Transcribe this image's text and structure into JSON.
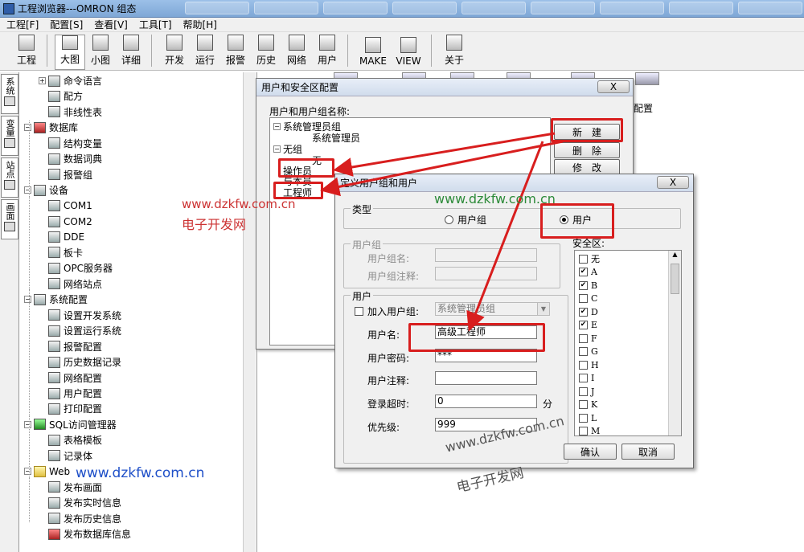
{
  "window": {
    "title": "工程浏览器---OMRON 组态"
  },
  "menu": [
    "工程[F]",
    "配置[S]",
    "查看[V]",
    "工具[T]",
    "帮助[H]"
  ],
  "toolbar": [
    "工程",
    "大图",
    "小图",
    "详细",
    "开发",
    "运行",
    "报警",
    "历史",
    "网络",
    "用户",
    "MAKE",
    "VIEW",
    "关于"
  ],
  "side_tabs": [
    "系统",
    "变量",
    "站点",
    "画面"
  ],
  "tree": [
    {
      "label": "命令语言",
      "level": 1,
      "exp": "+"
    },
    {
      "label": "配方",
      "level": 1
    },
    {
      "label": "非线性表",
      "level": 1
    },
    {
      "label": "数据库",
      "level": 0,
      "exp": "-"
    },
    {
      "label": "结构变量",
      "level": 1
    },
    {
      "label": "数据词典",
      "level": 1
    },
    {
      "label": "报警组",
      "level": 1
    },
    {
      "label": "设备",
      "level": 0,
      "exp": "-"
    },
    {
      "label": "COM1",
      "level": 1
    },
    {
      "label": "COM2",
      "level": 1
    },
    {
      "label": "DDE",
      "level": 1
    },
    {
      "label": "板卡",
      "level": 1
    },
    {
      "label": "OPC服务器",
      "level": 1
    },
    {
      "label": "网络站点",
      "level": 1
    },
    {
      "label": "系统配置",
      "level": 0,
      "exp": "-"
    },
    {
      "label": "设置开发系统",
      "level": 1
    },
    {
      "label": "设置运行系统",
      "level": 1
    },
    {
      "label": "报警配置",
      "level": 1
    },
    {
      "label": "历史数据记录",
      "level": 1
    },
    {
      "label": "网络配置",
      "level": 1
    },
    {
      "label": "用户配置",
      "level": 1
    },
    {
      "label": "打印配置",
      "level": 1
    },
    {
      "label": "SQL访问管理器",
      "level": 0,
      "exp": "-"
    },
    {
      "label": "表格模板",
      "level": 1
    },
    {
      "label": "记录体",
      "level": 1
    },
    {
      "label": "Web",
      "level": 0,
      "exp": "-"
    },
    {
      "label": "发布画面",
      "level": 1
    },
    {
      "label": "发布实时信息",
      "level": 1
    },
    {
      "label": "发布历史信息",
      "level": 1
    },
    {
      "label": "发布数据库信息",
      "level": 1
    }
  ],
  "bg_label": "配置",
  "dlg1": {
    "title": "用户和安全区配置",
    "list_label": "用户和用户组名称:",
    "items": [
      {
        "text": "系统管理员组",
        "indent": 0,
        "exp": "-"
      },
      {
        "text": "系统管理员",
        "indent": 1
      },
      {
        "text": "无组",
        "indent": 0,
        "exp": "-"
      },
      {
        "text": "无",
        "indent": 1
      },
      {
        "text": "操作员",
        "indent": 0
      },
      {
        "text": "与本员",
        "indent": 0
      },
      {
        "text": "工程师",
        "indent": 0
      }
    ],
    "btn_new": "新　建",
    "btn_delete": "删　除",
    "btn_edit": "修　改",
    "close": "X"
  },
  "dlg2": {
    "title": "定义用户组和用户",
    "type_label": "类型",
    "radio_group": "用户组",
    "radio_user": "用户",
    "group_section": "用户组",
    "group_name_label": "用户组名:",
    "group_note_label": "用户组注释:",
    "user_section": "用户",
    "join_group_label": "加入用户组:",
    "join_group_value": "系统管理员组",
    "username_label": "用户名:",
    "username_value": "高级工程师",
    "password_label": "用户密码:",
    "password_value": "***",
    "note_label": "用户注释:",
    "note_value": "",
    "timeout_label": "登录超时:",
    "timeout_value": "0",
    "timeout_unit": "分",
    "priority_label": "优先级:",
    "priority_value": "999",
    "security_label": "安全区:",
    "security_items": [
      {
        "name": "无",
        "checked": false
      },
      {
        "name": "A",
        "checked": true
      },
      {
        "name": "B",
        "checked": true
      },
      {
        "name": "C",
        "checked": false
      },
      {
        "name": "D",
        "checked": true
      },
      {
        "name": "E",
        "checked": true
      },
      {
        "name": "F",
        "checked": false
      },
      {
        "name": "G",
        "checked": false
      },
      {
        "name": "H",
        "checked": false
      },
      {
        "name": "I",
        "checked": false
      },
      {
        "name": "J",
        "checked": false
      },
      {
        "name": "K",
        "checked": false
      },
      {
        "name": "L",
        "checked": false
      },
      {
        "name": "M",
        "checked": false
      }
    ],
    "ok": "确认",
    "cancel": "取消",
    "close": "X"
  },
  "watermarks": {
    "url": "www.dzkfw.com.cn",
    "cn": "电子开发网"
  },
  "colors": {
    "highlight": "#d81e1e",
    "title_bar": "#9cc0e8",
    "url_blue": "#1e4fc8"
  }
}
